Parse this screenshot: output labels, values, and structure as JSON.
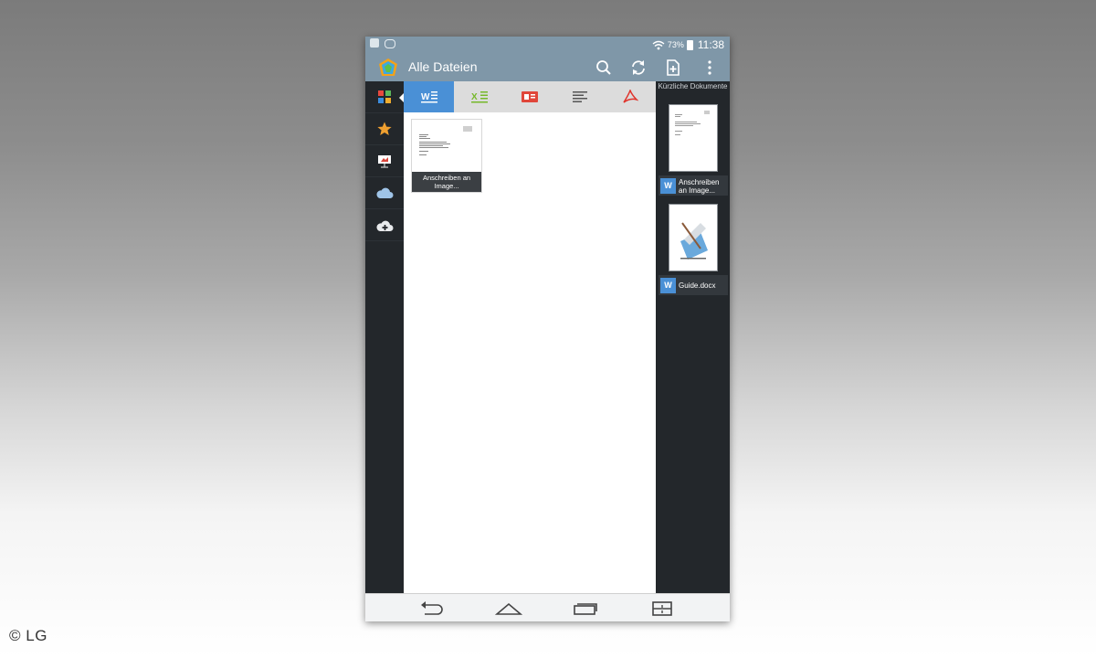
{
  "statusbar": {
    "battery": "73%",
    "time": "11:38"
  },
  "appbar": {
    "title": "Alle Dateien",
    "icons": [
      "search-icon",
      "refresh-icon",
      "new-document-icon",
      "overflow-menu-icon"
    ]
  },
  "leftnav": {
    "items": [
      "all-files-icon",
      "favorites-star-icon",
      "presentation-icon",
      "cloud-icon",
      "cloud-upload-icon"
    ]
  },
  "tabs": [
    "word",
    "excel",
    "powerpoint",
    "text",
    "pdf"
  ],
  "files": [
    {
      "label": "Anschreiben an Image..."
    }
  ],
  "recent": {
    "title": "Kürzliche Dokumente",
    "items": [
      {
        "label": "Anschreiben an Image..."
      },
      {
        "label": "Guide.docx"
      }
    ]
  },
  "navbar": [
    "back-icon",
    "home-icon",
    "recent-apps-icon",
    "menu-icon"
  ],
  "credit": "© LG",
  "colors": {
    "accent": "#4a90d6",
    "appbar": "#7f97a8",
    "dark_panel": "#23272b"
  }
}
